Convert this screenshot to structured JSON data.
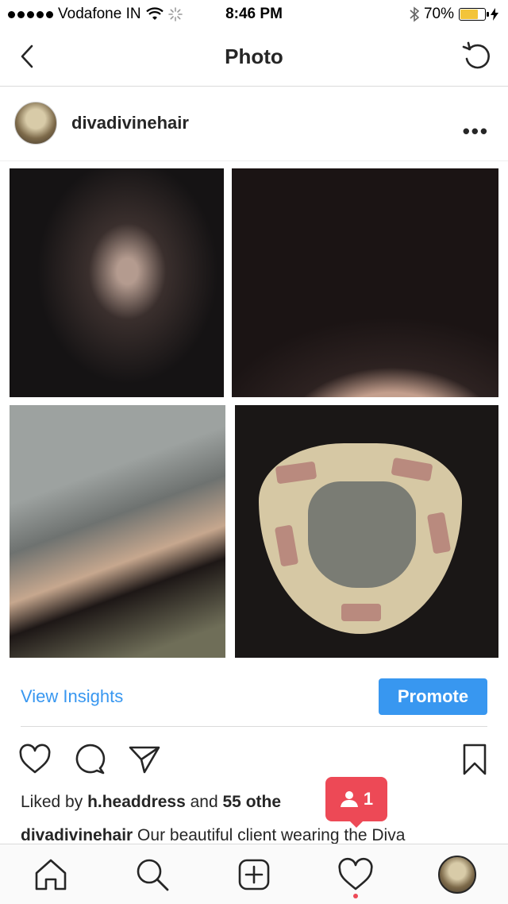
{
  "status_bar": {
    "carrier": "Vodafone IN",
    "time": "8:46 PM",
    "battery_percent": "70%",
    "battery_level": 0.7,
    "battery_color": "#f3c43a"
  },
  "nav": {
    "title": "Photo",
    "back_icon": "chevron-left-icon",
    "refresh_icon": "refresh-icon"
  },
  "post": {
    "username": "diva​divinehair",
    "more_label": "•••",
    "insights_label": "View Insights",
    "promote_label": "Promote",
    "likes_prefix": "Liked by ",
    "likes_user": "h.headdress",
    "likes_middle": " and ",
    "likes_count": "55 othe",
    "caption_user": "divadivinehair",
    "caption_text": " Our beautiful client wearing the Diva"
  },
  "notification": {
    "count": "1"
  },
  "colors": {
    "accent": "#3897f0",
    "notification": "#ed4956"
  }
}
